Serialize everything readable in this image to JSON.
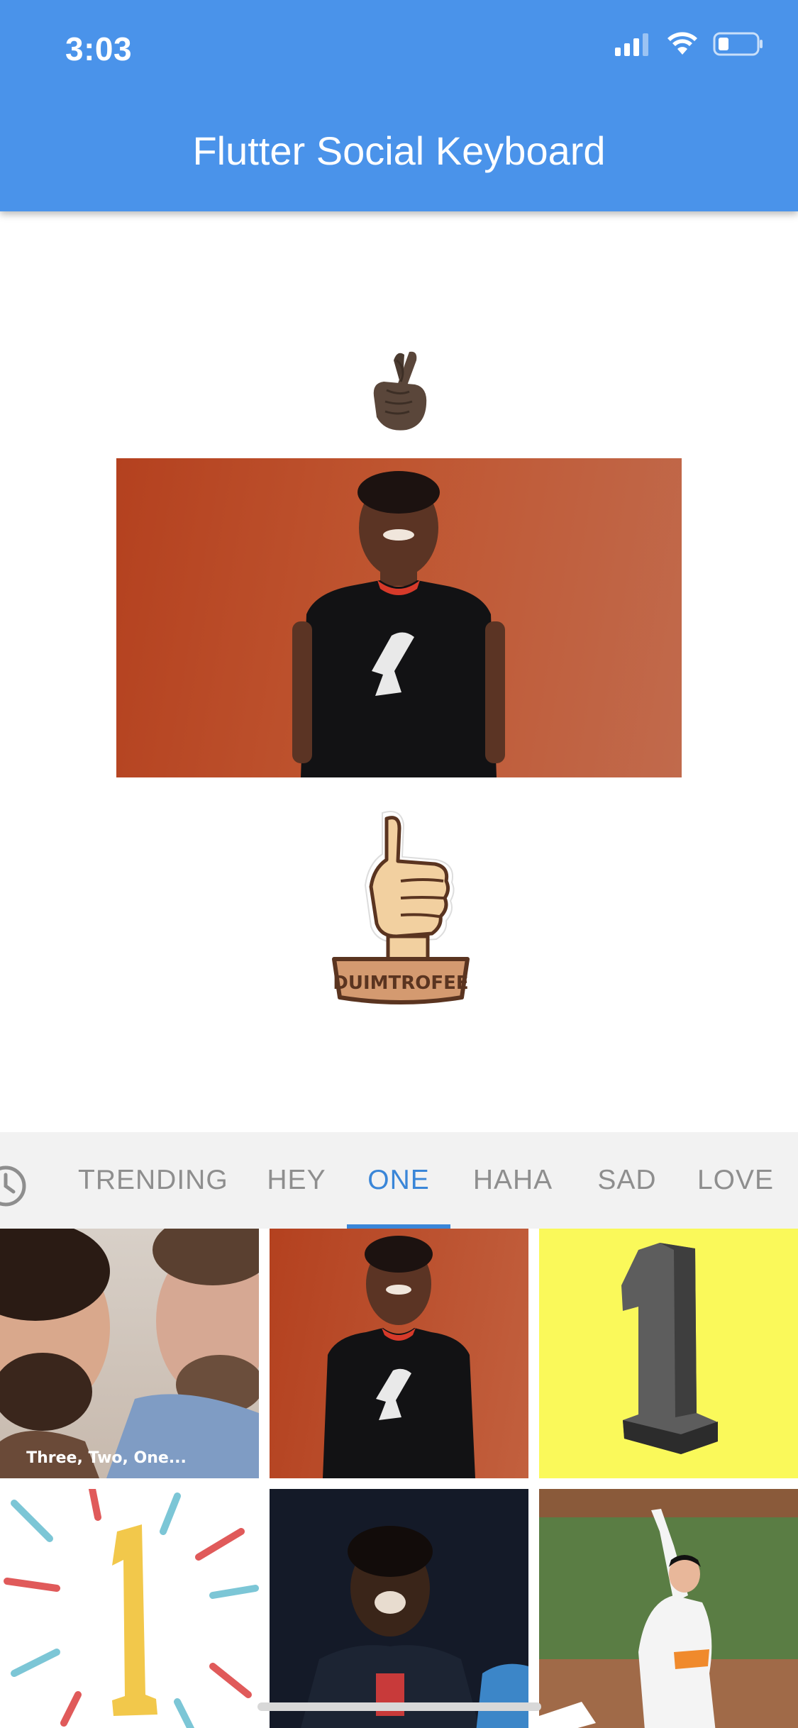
{
  "status_bar": {
    "time": "3:03",
    "icons": [
      "cellular-signal-icon",
      "wifi-icon",
      "battery-icon"
    ]
  },
  "app_bar": {
    "title": "Flutter Social Keyboard"
  },
  "conversation": {
    "items": [
      {
        "type": "emoji",
        "name": "crossed-fingers-icon"
      },
      {
        "type": "gif",
        "name": "smiling-woman-gif"
      },
      {
        "type": "sticker",
        "name": "thumbs-up-trophy-sticker",
        "sticker_text": "DUIMTROFEE"
      }
    ]
  },
  "keyboard": {
    "history_icon": "clock-icon",
    "tabs": [
      {
        "label": "TRENDING",
        "active": false
      },
      {
        "label": "HEY",
        "active": false
      },
      {
        "label": "ONE",
        "active": true
      },
      {
        "label": "HAHA",
        "active": false
      },
      {
        "label": "SAD",
        "active": false
      },
      {
        "label": "LOVE",
        "active": false
      }
    ],
    "gifs": [
      {
        "name": "two-men-gif",
        "caption": "Three, Two, One..."
      },
      {
        "name": "smiling-woman-gif"
      },
      {
        "name": "number-one-3d-gif"
      },
      {
        "name": "number-one-burst-gif"
      },
      {
        "name": "basketball-player-gif"
      },
      {
        "name": "baseball-player-gif"
      }
    ]
  },
  "colors": {
    "app_bar": "#4A93EA",
    "tab_bar_bg": "#F2F2F2",
    "tab_active": "#3A86D8",
    "tab_inactive": "#8E8E8E"
  }
}
